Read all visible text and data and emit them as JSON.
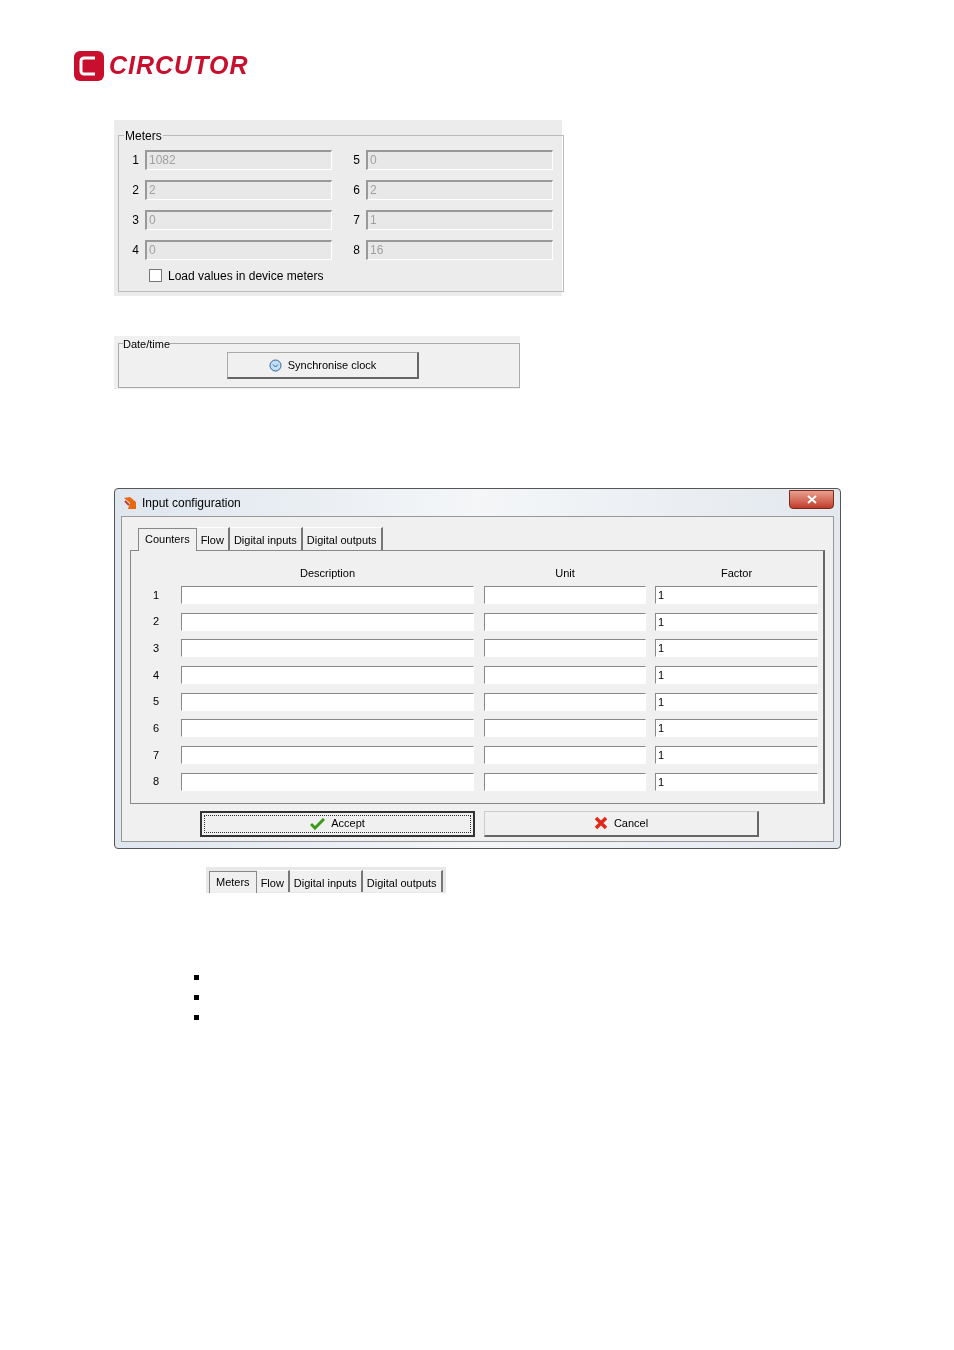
{
  "logo": {
    "text": "CIRCUTOR"
  },
  "meters_panel": {
    "title": "Meters",
    "meters": [
      {
        "label": "1",
        "value": "1082",
        "disabled": true
      },
      {
        "label": "2",
        "value": "2",
        "disabled": true
      },
      {
        "label": "3",
        "value": "0",
        "disabled": true
      },
      {
        "label": "4",
        "value": "0",
        "disabled": true
      },
      {
        "label": "5",
        "value": "0",
        "disabled": true
      },
      {
        "label": "6",
        "value": "2",
        "disabled": true
      },
      {
        "label": "7",
        "value": "1",
        "disabled": true
      },
      {
        "label": "8",
        "value": "16",
        "disabled": true
      }
    ],
    "load_values": {
      "label": "Load values in device meters",
      "checked": false
    }
  },
  "datetime_panel": {
    "title": "Date/time",
    "button": "Synchronise clock"
  },
  "dialog": {
    "title": "Input configuration",
    "tabs": [
      {
        "label": "Counters",
        "selected": true
      },
      {
        "label": "Flow",
        "selected": false
      },
      {
        "label": "Digital inputs",
        "selected": false
      },
      {
        "label": "Digital outputs",
        "selected": false
      }
    ],
    "columns": [
      "Description",
      "Unit",
      "Factor"
    ],
    "rows": [
      {
        "number": "1",
        "factor": "1"
      },
      {
        "number": "2",
        "factor": "1"
      },
      {
        "number": "3",
        "factor": "1"
      },
      {
        "number": "4",
        "factor": "1"
      },
      {
        "number": "5",
        "factor": "1"
      },
      {
        "number": "6",
        "factor": "1"
      },
      {
        "number": "7",
        "factor": "1"
      },
      {
        "number": "8",
        "factor": "1"
      }
    ],
    "buttons": [
      {
        "label": "Accept",
        "kind": "accept",
        "focused": true
      },
      {
        "label": "Cancel",
        "kind": "cancel",
        "focused": false
      }
    ]
  },
  "tab_strip": {
    "tabs": [
      {
        "label": "Meters",
        "selected": true
      },
      {
        "label": "Flow",
        "selected": false
      },
      {
        "label": "Digital inputs",
        "selected": false
      },
      {
        "label": "Digital outputs",
        "selected": false
      }
    ]
  }
}
